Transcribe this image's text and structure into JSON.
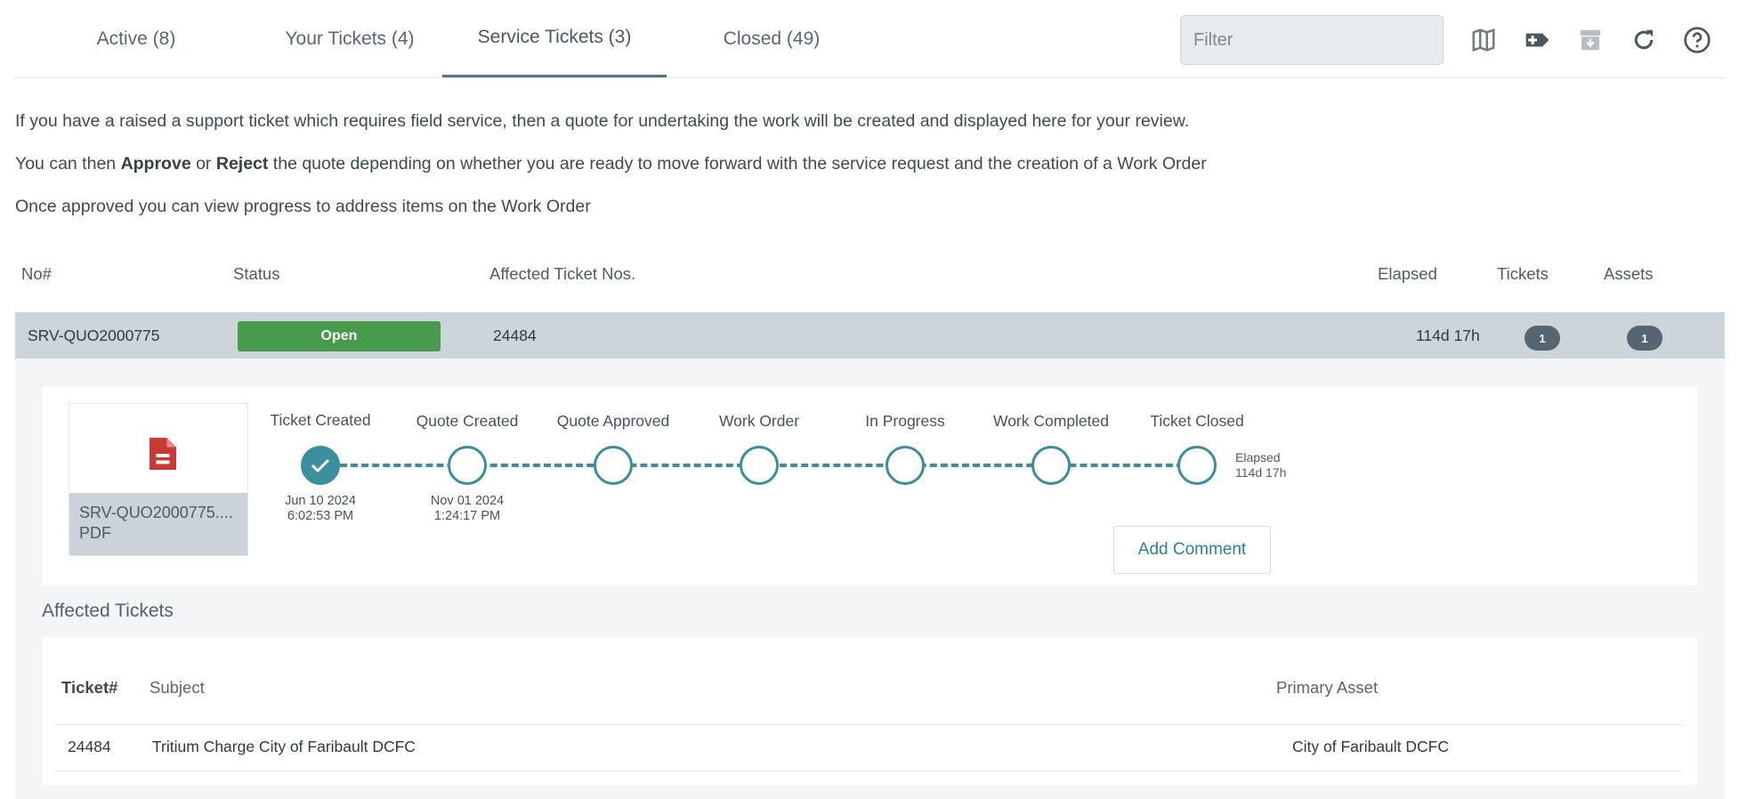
{
  "tabs": [
    {
      "label": "Active (8)",
      "active": false
    },
    {
      "label": "Your Tickets (4)",
      "active": false
    },
    {
      "label": "Service Tickets (3)",
      "active": true
    },
    {
      "label": "Closed (49)",
      "active": false
    }
  ],
  "filter": {
    "placeholder": "Filter"
  },
  "toolbar_icons": [
    "map-icon",
    "add-ticket-icon",
    "archive-icon",
    "refresh-icon",
    "help-icon"
  ],
  "intro": {
    "line1": "If you have a raised a support ticket which requires field service, then a quote for undertaking the work will be created and displayed here for your review.",
    "line2_a": "You can then ",
    "line2_approve": "Approve",
    "line2_or": " or ",
    "line2_reject": "Reject",
    "line2_b": " the quote depending on whether you are ready to move forward with the service request and the creation of a Work Order",
    "line3": "Once approved you can view progress to address items on the Work Order"
  },
  "table": {
    "headers": {
      "no": "No#",
      "status": "Status",
      "affected": "Affected Ticket Nos.",
      "elapsed": "Elapsed",
      "tickets": "Tickets",
      "assets": "Assets"
    },
    "row": {
      "no": "SRV-QUO2000775",
      "status": "Open",
      "affected": "24484",
      "elapsed": "114d 17h",
      "tickets": "1",
      "assets": "1"
    }
  },
  "detail": {
    "document": {
      "name": "SRV-QUO2000775....",
      "type": "PDF"
    },
    "steps": [
      {
        "label": "Ticket Created",
        "done": true,
        "date": "Jun 10 2024",
        "time": "6:02:53 PM"
      },
      {
        "label": "Quote Created",
        "done": false,
        "date": "Nov 01 2024",
        "time": "1:24:17 PM"
      },
      {
        "label": "Quote Approved",
        "done": false
      },
      {
        "label": "Work Order",
        "done": false
      },
      {
        "label": "In Progress",
        "done": false
      },
      {
        "label": "Work Completed",
        "done": false
      },
      {
        "label": "Ticket Closed",
        "done": false
      }
    ],
    "elapsed_label": "Elapsed",
    "elapsed_value": "114d 17h",
    "add_comment": "Add Comment"
  },
  "affected_tickets": {
    "title": "Affected Tickets",
    "headers": {
      "ticket": "Ticket#",
      "subject": "Subject",
      "asset": "Primary Asset"
    },
    "rows": [
      {
        "ticket": "24484",
        "subject": "Tritium Charge City of Faribault DCFC",
        "asset": "City of Faribault DCFC"
      }
    ]
  },
  "colors": {
    "accent": "#3b8e9e",
    "open_badge": "#469b4c",
    "doc_icon": "#c83a34"
  }
}
